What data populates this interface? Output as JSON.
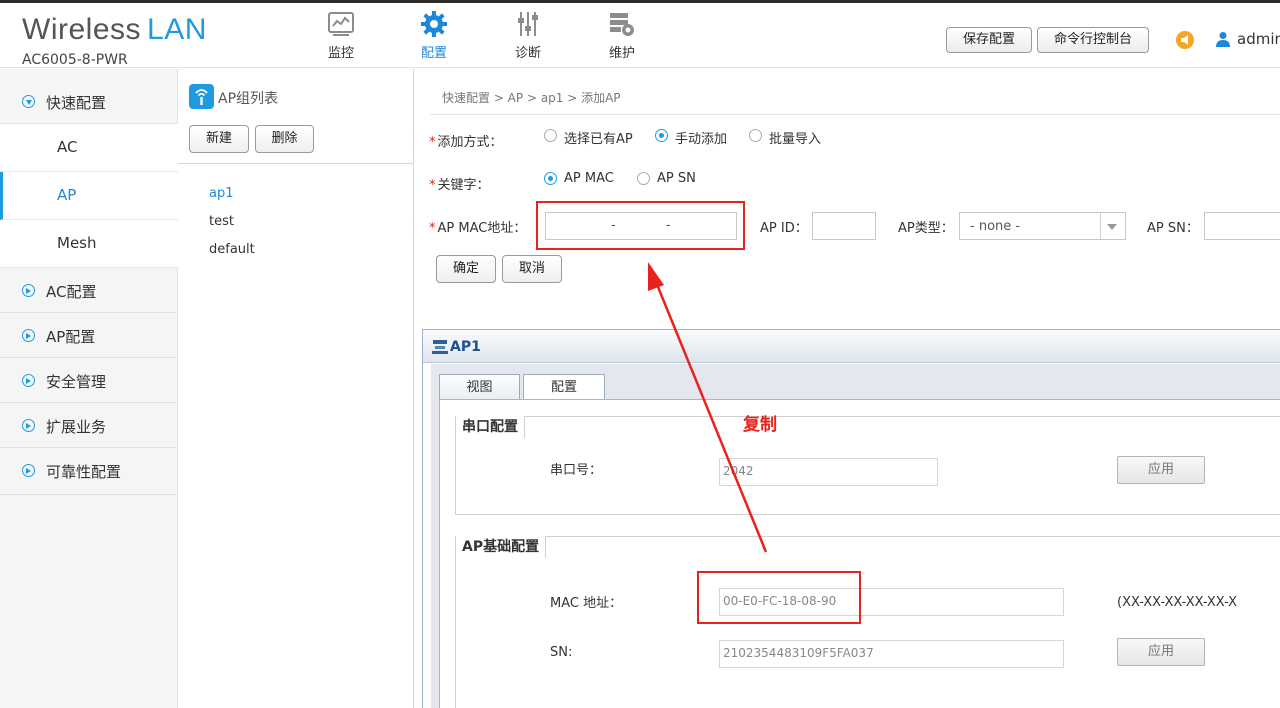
{
  "brand": {
    "title_main": "Wireless",
    "title_accent": "LAN",
    "model": "AC6005-8-PWR"
  },
  "nav": [
    {
      "label": "监控",
      "icon": "monitor-icon",
      "active": false
    },
    {
      "label": "配置",
      "icon": "gear-icon",
      "active": true
    },
    {
      "label": "诊断",
      "icon": "sliders-icon",
      "active": false
    },
    {
      "label": "维护",
      "icon": "maintenance-icon",
      "active": false
    }
  ],
  "header_actions": {
    "save_label": "保存配置",
    "cli_label": "命令行控制台",
    "username": "admin"
  },
  "sidebar": {
    "quick": "快速配置",
    "subitems": [
      "AC",
      "AP",
      "Mesh"
    ],
    "items": [
      "AC配置",
      "AP配置",
      "安全管理",
      "扩展业务",
      "可靠性配置"
    ]
  },
  "group_panel": {
    "title": "AP组列表",
    "new_label": "新建",
    "delete_label": "删除",
    "groups": [
      "ap1",
      "test",
      "default"
    ]
  },
  "breadcrumb": "快速配置 > AP > ap1 > 添加AP",
  "form": {
    "add_method_label": "添加方式：",
    "add_method_options": [
      "选择已有AP",
      "手动添加",
      "批量导入"
    ],
    "key_label": "关键字：",
    "key_options": [
      "AP MAC",
      "AP SN"
    ],
    "mac_label": "AP MAC地址：",
    "mac_separators": [
      "-",
      "-"
    ],
    "apid_label": "AP ID：",
    "aptype_label": "AP类型：",
    "aptype_value": "- none -",
    "apsn_label": "AP SN：",
    "ok_label": "确定",
    "cancel_label": "取消"
  },
  "ap1_window": {
    "title": "AP1",
    "tabs": [
      "视图",
      "配置"
    ],
    "serial_section": "串口配置",
    "serial_label": "串口号：",
    "serial_value": "2042",
    "apply_label": "应用",
    "basic_section": "AP基础配置",
    "mac_label": "MAC 地址：",
    "mac_value": "00-E0-FC-18-08-90",
    "mac_hint": "(XX-XX-XX-XX-XX-X",
    "sn_label": "SN:",
    "sn_value": "2102354483109F5FA037",
    "apply_label_2": "应用"
  },
  "annotation": {
    "copy_label": "复制",
    "color": "#e8221c"
  },
  "colors": {
    "accent": "#1e9be0",
    "annotation": "#e8221c"
  }
}
